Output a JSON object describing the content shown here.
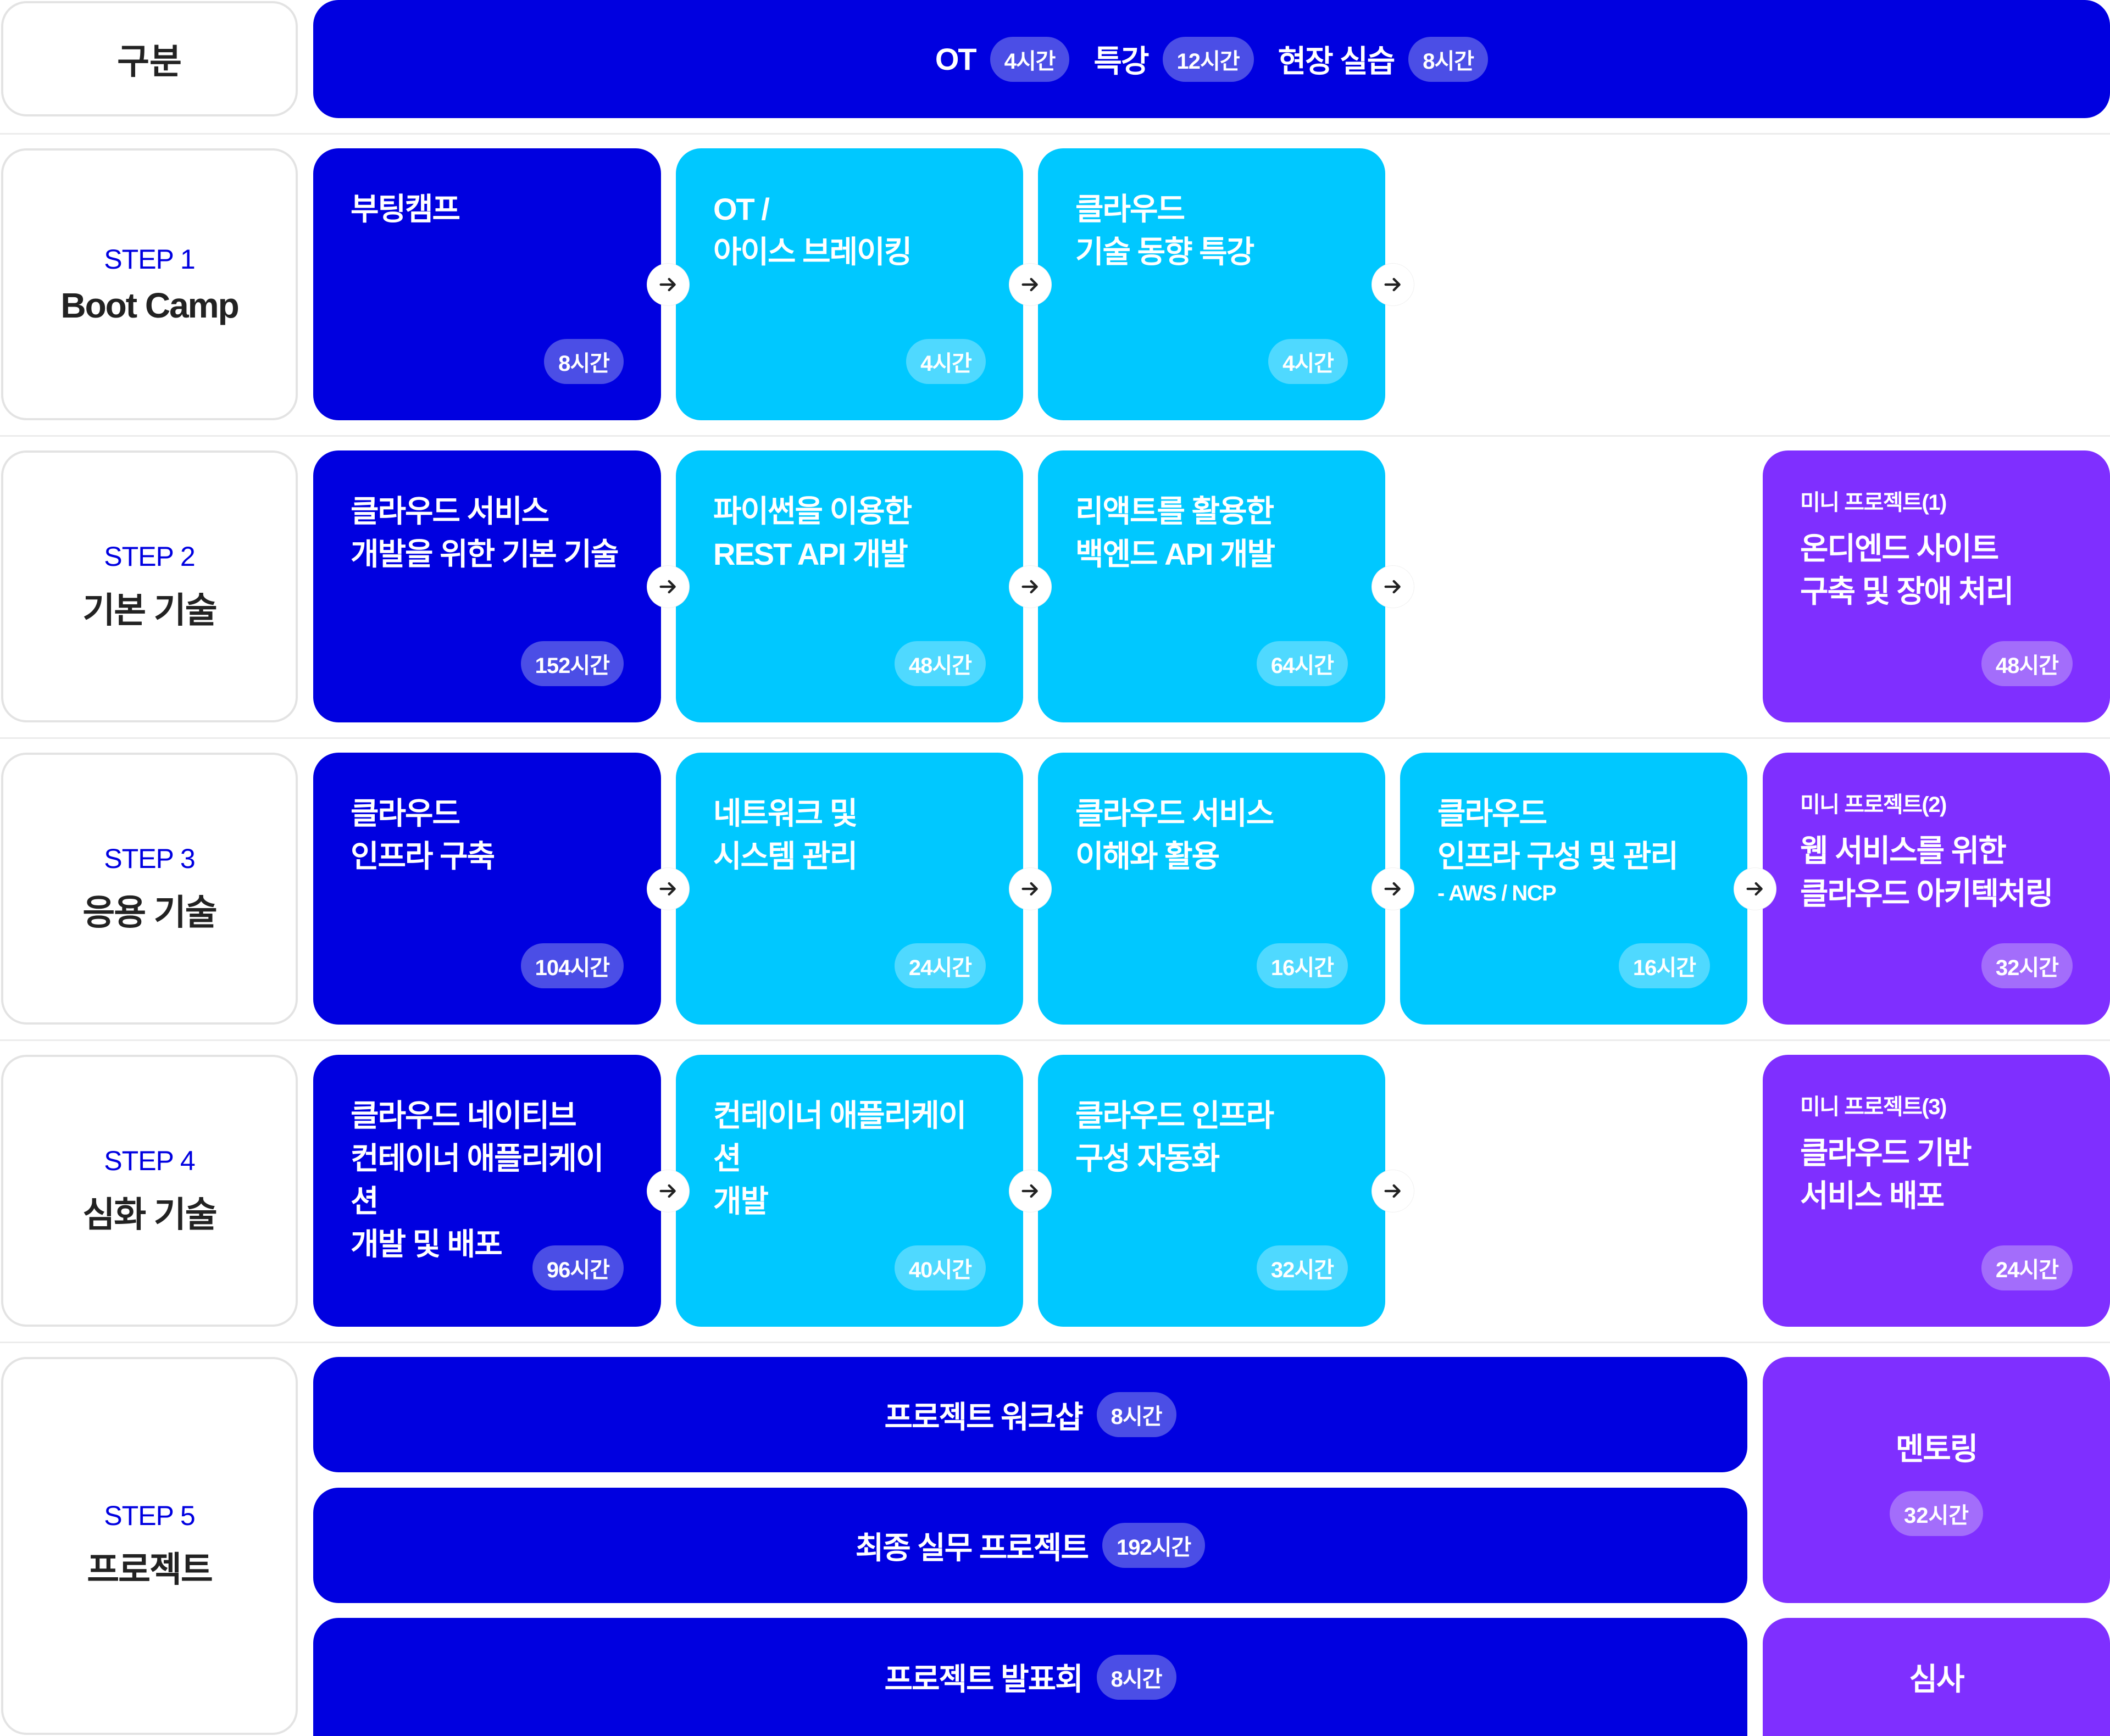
{
  "header": {
    "label": "구분",
    "items": [
      {
        "name": "OT",
        "hours": "4시간"
      },
      {
        "name": "특강",
        "hours": "12시간"
      },
      {
        "name": "현장 실습",
        "hours": "8시간"
      }
    ]
  },
  "steps": [
    {
      "step": "STEP 1",
      "title": "Boot Camp",
      "cards": [
        {
          "title": "부팅캠프",
          "hours": "8시간",
          "kind": "core"
        },
        {
          "title": "OT /\n아이스 브레이킹",
          "hours": "4시간",
          "kind": "sub"
        },
        {
          "title": "클라우드\n기술 동향 특강",
          "hours": "4시간",
          "kind": "sub"
        }
      ]
    },
    {
      "step": "STEP 2",
      "title": "기본 기술",
      "cards": [
        {
          "title": "클라우드 서비스\n개발을 위한 기본 기술",
          "hours": "152시간",
          "kind": "core"
        },
        {
          "title": "파이썬을 이용한\nREST API 개발",
          "hours": "48시간",
          "kind": "sub"
        },
        {
          "title": "리액트를 활용한\n백엔드 API 개발",
          "hours": "64시간",
          "kind": "sub"
        }
      ],
      "project": {
        "kicker": "미니 프로젝트(1)",
        "title": "온디엔드 사이트\n구축 및 장애 처리",
        "hours": "48시간"
      }
    },
    {
      "step": "STEP 3",
      "title": "응용 기술",
      "cards": [
        {
          "title": "클라우드\n인프라 구축",
          "hours": "104시간",
          "kind": "core"
        },
        {
          "title": "네트워크 및\n시스템 관리",
          "hours": "24시간",
          "kind": "sub"
        },
        {
          "title": "클라우드 서비스\n이해와 활용",
          "hours": "16시간",
          "kind": "sub"
        },
        {
          "title": "클라우드\n인프라 구성 및 관리",
          "subtitle": "- AWS / NCP",
          "hours": "16시간",
          "kind": "sub"
        }
      ],
      "project": {
        "kicker": "미니 프로젝트(2)",
        "title": "웹 서비스를 위한\n클라우드 아키텍처링",
        "hours": "32시간"
      }
    },
    {
      "step": "STEP 4",
      "title": "심화 기술",
      "cards": [
        {
          "title": "클라우드 네이티브\n컨테이너 애플리케이션\n개발 및 배포",
          "hours": "96시간",
          "kind": "core"
        },
        {
          "title": "컨테이너 애플리케이션\n개발",
          "hours": "40시간",
          "kind": "sub"
        },
        {
          "title": "클라우드 인프라\n구성 자동화",
          "hours": "32시간",
          "kind": "sub"
        }
      ],
      "project": {
        "kicker": "미니 프로젝트(3)",
        "title": "클라우드 기반\n서비스 배포",
        "hours": "24시간"
      }
    },
    {
      "step": "STEP 5",
      "title": "프로젝트",
      "bars": [
        {
          "title": "프로젝트 워크샵",
          "hours": "8시간"
        },
        {
          "title": "최종 실무 프로젝트",
          "hours": "192시간"
        },
        {
          "title": "프로젝트 발표회",
          "hours": "8시간"
        }
      ],
      "side": [
        {
          "title": "멘토링",
          "hours": "32시간"
        },
        {
          "title": "심사"
        }
      ]
    }
  ],
  "colors": {
    "core": "#0000e0",
    "sub": "#00c8ff",
    "project": "#7f2fff",
    "step_label": "#0000e0"
  }
}
